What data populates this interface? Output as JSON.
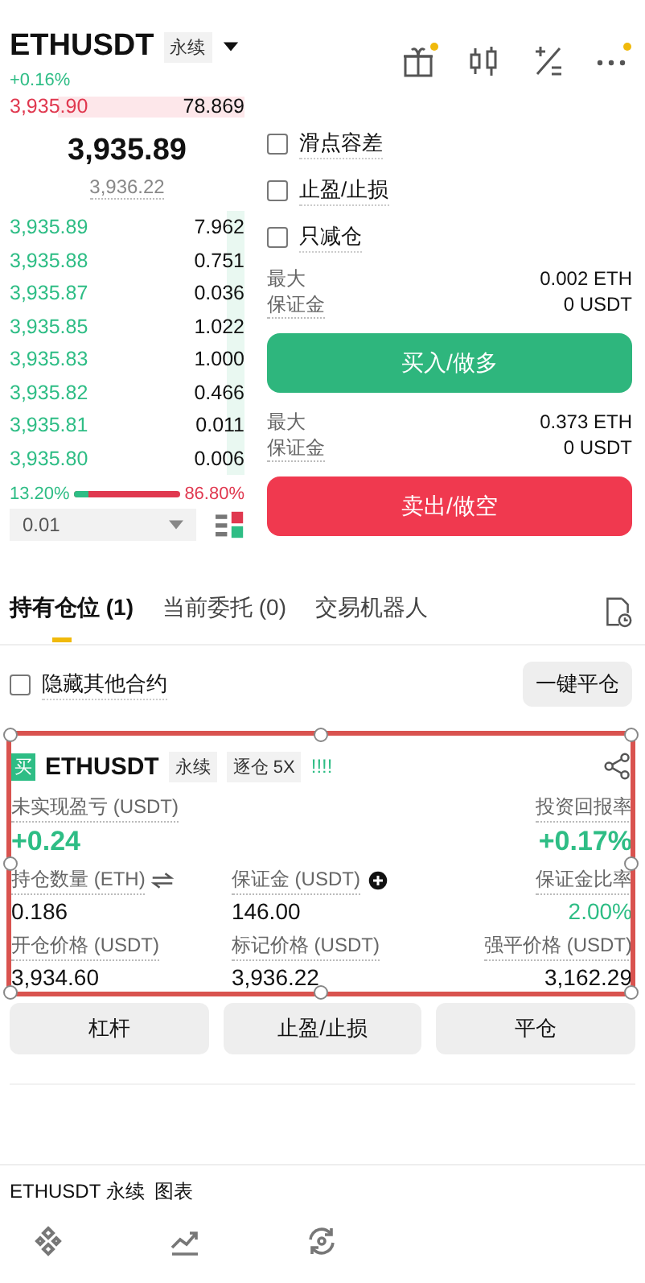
{
  "header": {
    "symbol": "ETHUSDT",
    "contract_type": "永续",
    "change": "+0.16%"
  },
  "order_book": {
    "ask_rows": [
      {
        "price": "3,935.90",
        "qty": "78.869"
      }
    ],
    "last_price": "3,935.89",
    "mark_price": "3,936.22",
    "bid_rows": [
      {
        "price": "3,935.89",
        "qty": "7.962"
      },
      {
        "price": "3,935.88",
        "qty": "0.751"
      },
      {
        "price": "3,935.87",
        "qty": "0.036"
      },
      {
        "price": "3,935.85",
        "qty": "1.022"
      },
      {
        "price": "3,935.83",
        "qty": "1.000"
      },
      {
        "price": "3,935.82",
        "qty": "0.466"
      },
      {
        "price": "3,935.81",
        "qty": "0.011"
      },
      {
        "price": "3,935.80",
        "qty": "0.006"
      }
    ],
    "buy_ratio": "13.20%",
    "sell_ratio": "86.80%",
    "ratio": {
      "level": 0.132
    },
    "precision": "0.01"
  },
  "order_options": [
    {
      "label": "滑点容差",
      "checked": false
    },
    {
      "label": "止盈/止损",
      "checked": false
    },
    {
      "label": "只减仓",
      "checked": false
    }
  ],
  "buy": {
    "max_label": "最大",
    "max_value": "0.002 ETH",
    "margin_label": "保证金",
    "margin_value": "0 USDT",
    "button": "买入/做多"
  },
  "sell": {
    "max_label": "最大",
    "max_value": "0.373 ETH",
    "margin_label": "保证金",
    "margin_value": "0 USDT",
    "button": "卖出/做空"
  },
  "tabs": [
    {
      "label": "持有仓位 (1)",
      "selected": true
    },
    {
      "label": "当前委托 (0)",
      "selected": false
    },
    {
      "label": "交易机器人",
      "selected": false
    }
  ],
  "hide_others": {
    "label": "隐藏其他合约",
    "checked": false
  },
  "close_all": "一键平仓",
  "position": {
    "side": "买",
    "symbol": "ETHUSDT",
    "tags": [
      "永续",
      "逐仓 5X"
    ],
    "signal": "!!!!",
    "pnl": {
      "label": "未实现盈亏 (USDT)",
      "value": "+0.24"
    },
    "roe": {
      "label": "投资回报率",
      "value": "+0.17%"
    },
    "rows": [
      [
        {
          "label": "持仓数量 (ETH)",
          "value": "0.186",
          "up": false
        },
        {
          "label": "保证金 (USDT)",
          "value": "146.00",
          "up": false
        },
        {
          "label": "保证金比率",
          "value": "2.00%",
          "up": true
        }
      ],
      [
        {
          "label": "开仓价格 (USDT)",
          "value": "3,934.60",
          "up": false
        },
        {
          "label": "标记价格 (USDT)",
          "value": "3,936.22",
          "up": false
        },
        {
          "label": "强平价格 (USDT)",
          "value": "3,162.29",
          "up": false
        }
      ]
    ]
  },
  "actions": [
    "杠杆",
    "止盈/止损",
    "平仓"
  ],
  "footer": [
    "ETHUSDT 永续",
    "图表"
  ]
}
